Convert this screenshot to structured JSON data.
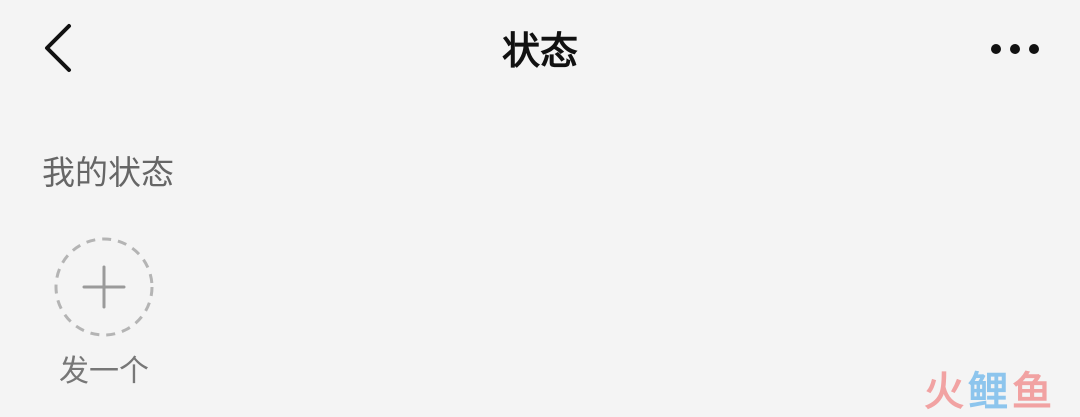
{
  "header": {
    "title": "状态",
    "back_icon": "chevron-left-icon",
    "more_icon": "more-horizontal-icon"
  },
  "my_status": {
    "section_label": "我的状态",
    "add_icon": "plus-icon",
    "add_label": "发一个"
  },
  "watermark": {
    "chars": [
      "火",
      "鲤",
      "鱼"
    ]
  },
  "colors": {
    "background": "#f4f4f4",
    "title": "#111111",
    "label": "#666666",
    "dashed_circle": "#b4b4b4"
  }
}
